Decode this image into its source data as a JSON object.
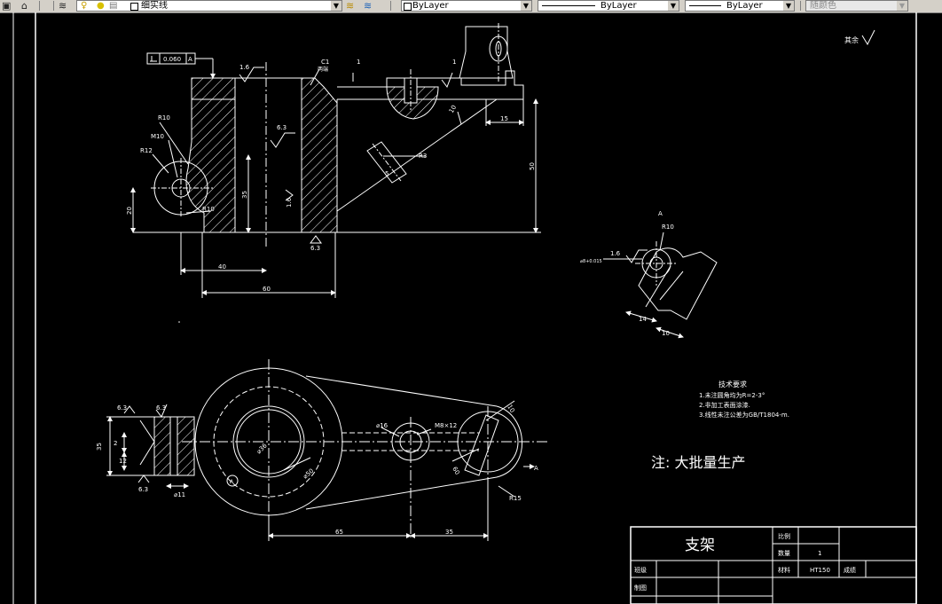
{
  "toolbar": {
    "layer_name": "细实线",
    "color_value": "ByLayer",
    "linetype_value": "ByLayer",
    "lineweight_value": "ByLayer",
    "plotstyle_value": "随颜色",
    "icons": [
      "layer-manager-icon",
      "layer-previous-icon",
      "lightbulb-icon",
      "sun-icon",
      "lock-icon"
    ]
  },
  "drawing": {
    "title": "支架",
    "note": "注: 大批量生产",
    "roughness_note": "其余",
    "tech_req": {
      "heading": "技术要求",
      "items": [
        "1.未注圆角均为R=2-3°",
        "2.非加工表面涂漆.",
        "3.线性未注公差为GB/T1804-m."
      ]
    },
    "title_block": {
      "scale_label": "比例",
      "qty_label": "数量",
      "qty_value": "1",
      "material_label": "材料",
      "material_value": "HT150",
      "grade_label": "成绩",
      "class_label": "班级",
      "drawn_label": "制图"
    },
    "front_view": {
      "flatness_tol": "0.060",
      "datum_a": "A",
      "chamfer": "C1",
      "chamfer_note": "两端",
      "dim_1a": "1",
      "dim_1b": "1",
      "rough_16_top": "1.6",
      "rough_63_mid": "6.3",
      "rough_16_left": "1.6",
      "rough_63_bottom": "6.3",
      "r10_top": "R10",
      "m10": "M10",
      "r12": "R12",
      "r10_bottom": "R10",
      "dim_20": "20",
      "dim_35": "35",
      "dim_40": "40",
      "dim_60": "60",
      "dim_15": "15",
      "dim_50": "50",
      "dim_5": "5",
      "r3": "R3",
      "dim_10": "10"
    },
    "aux_view": {
      "datum_a": "A",
      "r10": "R10",
      "rough_16": "1.6",
      "bore_dim": "⌀8+0.015",
      "dim_14": "14",
      "dim_10": "10"
    },
    "top_view": {
      "rough_63_a": "6.3",
      "rough_63_b": "6.3",
      "rough_63_c": "6.3",
      "dim_2": "2",
      "dim_12": "12",
      "dim_35_left": "35",
      "dim_phi11": "⌀11",
      "bore_phi": "⌀36",
      "phi_16": "⌀16",
      "m8": "M8×12",
      "phi_50": "⌀50",
      "dim_10": "10",
      "r15": "R15",
      "dim_65": "65",
      "dim_35": "35",
      "dim_60": "60",
      "view_a": "A",
      "circle_a": "A"
    }
  }
}
